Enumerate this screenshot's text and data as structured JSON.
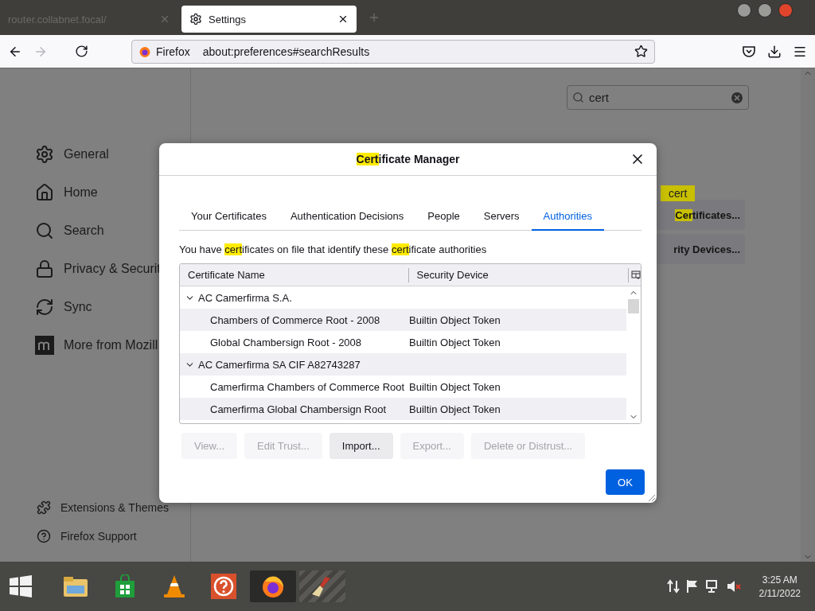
{
  "browser": {
    "tabs": [
      {
        "title": "router.collabnet.focal/",
        "selected": false
      },
      {
        "title": "Settings",
        "selected": true
      }
    ],
    "url": {
      "identity": "Firefox",
      "address": "about:preferences#searchResults"
    }
  },
  "sidebar": {
    "items": [
      {
        "label": "General"
      },
      {
        "label": "Home"
      },
      {
        "label": "Search"
      },
      {
        "label": "Privacy & Securit"
      },
      {
        "label": "Sync"
      },
      {
        "label": "More from Mozill"
      }
    ],
    "footer": [
      {
        "label": "Extensions & Themes"
      },
      {
        "label": "Firefox Support"
      }
    ]
  },
  "search": {
    "value": "cert"
  },
  "results": {
    "badge": "cert",
    "buttons": [
      {
        "segments": [
          {
            "text": "Cer",
            "highlight": true
          },
          {
            "text": "tificates...",
            "highlight": false
          }
        ]
      },
      {
        "segments": [
          {
            "text": "rity Devices...",
            "highlight": false
          }
        ]
      }
    ]
  },
  "dialog": {
    "title": [
      {
        "text": "Cert",
        "highlight": true
      },
      {
        "text": "ificate Manager",
        "highlight": false
      }
    ],
    "tabs": [
      {
        "label": "Your Certificates",
        "selected": false
      },
      {
        "label": "Authentication Decisions",
        "selected": false
      },
      {
        "label": "People",
        "selected": false
      },
      {
        "label": "Servers",
        "selected": false
      },
      {
        "label": "Authorities",
        "selected": true
      }
    ],
    "description": [
      {
        "text": "You have ",
        "highlight": false
      },
      {
        "text": "cert",
        "highlight": true
      },
      {
        "text": "ificates on file that identify these ",
        "highlight": false
      },
      {
        "text": "cert",
        "highlight": true
      },
      {
        "text": "ificate authorities",
        "highlight": false
      }
    ],
    "columns": [
      "Certificate Name",
      "Security Device"
    ],
    "groups": [
      {
        "name": "AC Camerfirma S.A.",
        "expanded": true,
        "children": [
          {
            "name": "Chambers of Commerce Root - 2008",
            "device": "Builtin Object Token"
          },
          {
            "name": "Global Chambersign Root - 2008",
            "device": "Builtin Object Token"
          }
        ]
      },
      {
        "name": "AC Camerfirma SA CIF A82743287",
        "expanded": true,
        "children": [
          {
            "name": "Camerfirma Chambers of Commerce Root",
            "device": "Builtin Object Token"
          },
          {
            "name": "Camerfirma Global Chambersign Root",
            "device": "Builtin Object Token"
          }
        ]
      }
    ],
    "buttons": [
      {
        "label": "View...",
        "disabled": true
      },
      {
        "label": "Edit Trust...",
        "disabled": true
      },
      {
        "label": "Import...",
        "disabled": false
      },
      {
        "label": "Export...",
        "disabled": true
      },
      {
        "label": "Delete or Distrust...",
        "disabled": true
      }
    ],
    "ok": "OK"
  },
  "taskbar": {
    "apps": [
      {
        "kind": "explorer",
        "active": false
      },
      {
        "kind": "store",
        "active": false
      },
      {
        "kind": "vlc",
        "active": false
      },
      {
        "kind": "help",
        "active": false
      },
      {
        "kind": "firefox",
        "active": true
      },
      {
        "kind": "cleaner",
        "active": false
      }
    ],
    "time": "3:25 AM",
    "date": "2/11/2022"
  }
}
